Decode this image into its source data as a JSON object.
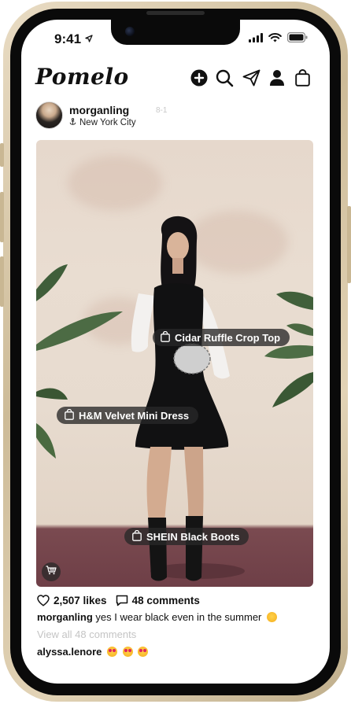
{
  "status_bar": {
    "time": "9:41",
    "icons": [
      "location-arrow-icon",
      "signal-icon",
      "wifi-icon",
      "battery-icon"
    ]
  },
  "header": {
    "logo": "Pomelo",
    "icons": [
      "add-circle-icon",
      "search-icon",
      "paper-plane-icon",
      "profile-icon",
      "shopping-bag-icon"
    ]
  },
  "post": {
    "username": "morganling",
    "date": "8-1",
    "location": "New York City",
    "tags": [
      {
        "label": "Cidar Ruffle Crop Top"
      },
      {
        "label": "H&M Velvet Mini Dress"
      },
      {
        "label": "SHEIN Black Boots"
      }
    ],
    "likes": "2,507 likes",
    "comments_count": "48 comments",
    "caption_user": "morganling",
    "caption_text": "yes I wear black even in the summer",
    "view_all": "View all 48 comments",
    "comment_user": "alyssa.lenore"
  },
  "colors": {
    "frame_gold": "#cdbb98",
    "tag_bg": "#282828",
    "muted_text": "#c4c4c4"
  }
}
